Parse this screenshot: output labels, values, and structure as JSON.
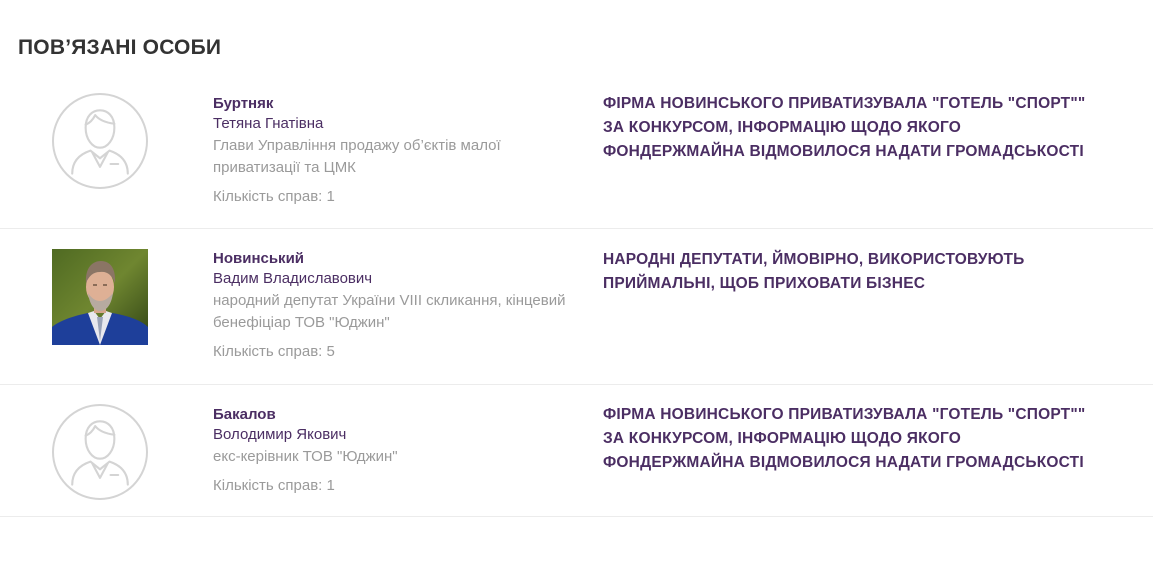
{
  "section": {
    "title": "ПОВ’ЯЗАНІ ОСОБИ"
  },
  "persons": [
    {
      "surname": "Буртняк",
      "given_name": "Тетяна Гнатівна",
      "position": "Глави Управління продажу об’єктів малої приватизації та ЦМК",
      "cases": "Кількість справ: 1",
      "article": "ФІРМА НОВИНСЬКОГО ПРИВАТИЗУВАЛА \"ГОТЕЛЬ \"СПОРТ\"\" ЗА КОНКУРСОМ, ІНФОРМАЦІЮ ЩОДО ЯКОГО ФОНДЕРЖМАЙНА ВІДМОВИЛОСЯ НАДАТИ ГРОМАДСЬКОСТІ",
      "avatar": "user-placeholder-icon"
    },
    {
      "surname": "Новинський",
      "given_name": "Вадим Владиславович",
      "position": "народний депутат України VIII скликання, кінцевий бенефіціар ТОВ \"Юджин\"",
      "cases": "Кількість справ: 5",
      "article": "НАРОДНІ ДЕПУТАТИ, ЙМОВІРНО, ВИКОРИСТОВУЮТЬ ПРИЙМАЛЬНІ, ЩОБ ПРИХОВАТИ БІЗНЕС",
      "avatar": "portrait-photo"
    },
    {
      "surname": "Бакалов",
      "given_name": "Володимир Якович",
      "position": "екс-керівник ТОВ \"Юджин\"",
      "cases": "Кількість справ: 1",
      "article": "ФІРМА НОВИНСЬКОГО ПРИВАТИЗУВАЛА \"ГОТЕЛЬ \"СПОРТ\"\" ЗА КОНКУРСОМ, ІНФОРМАЦІЮ ЩОДО ЯКОГО ФОНДЕРЖМАЙНА ВІДМОВИЛОСЯ НАДАТИ ГРОМАДСЬКОСТІ",
      "avatar": "user-placeholder-icon"
    }
  ],
  "colors": {
    "accent": "#4b2e63",
    "muted": "#9a9a9a",
    "title": "#333333",
    "divider": "#ececec"
  }
}
